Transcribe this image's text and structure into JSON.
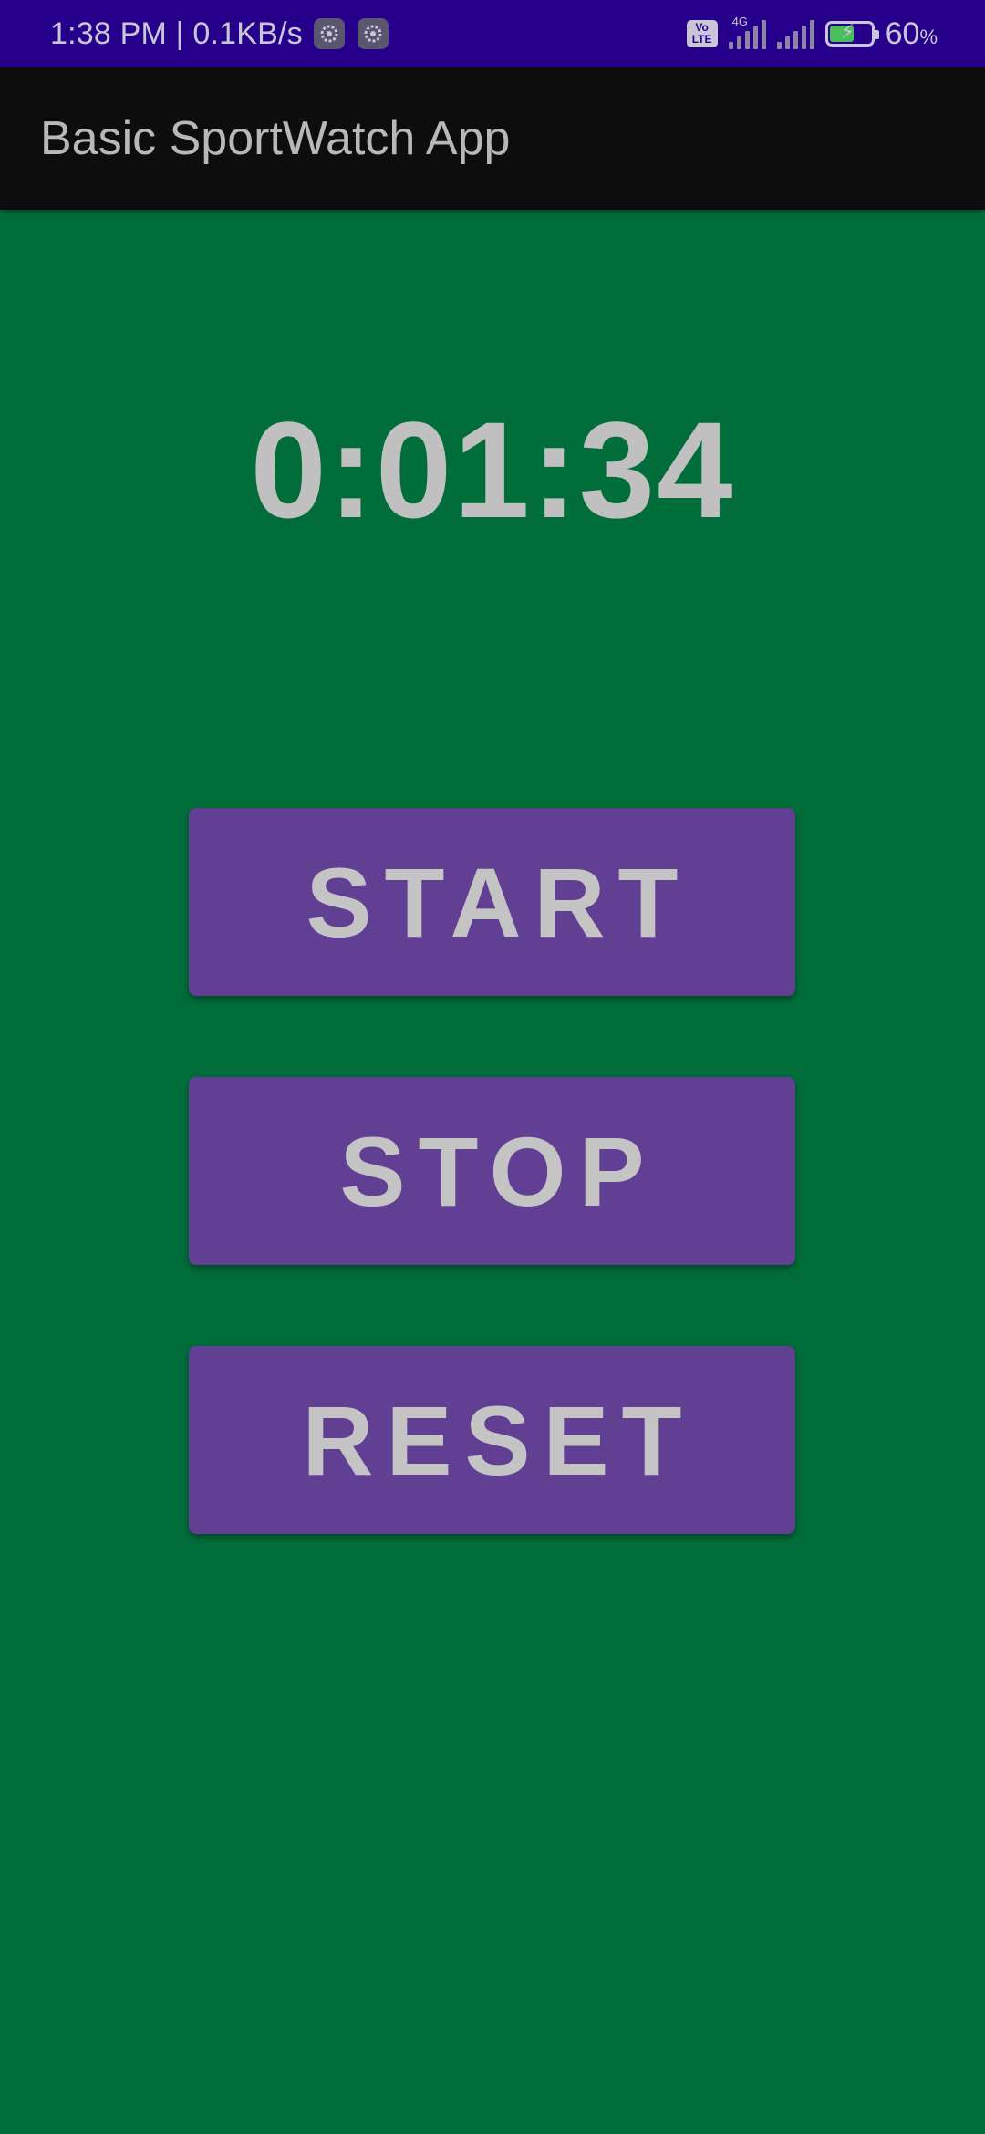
{
  "status_bar": {
    "time_speed": "1:38 PM | 0.1KB/s",
    "notification_icons": [
      "settings-gear-icon",
      "settings-gear-icon"
    ],
    "volte_top": "Vo",
    "volte_bottom": "LTE",
    "network_type": "4G",
    "battery_percent": "60",
    "battery_percent_sign": "%",
    "battery_level": 0.6,
    "charging": true
  },
  "app_bar": {
    "title": "Basic SportWatch App"
  },
  "timer": {
    "value": "0:01:34"
  },
  "buttons": {
    "start_label": "START",
    "stop_label": "STOP",
    "reset_label": "RESET"
  },
  "colors": {
    "status_bar_bg": "#26008a",
    "app_bar_bg": "#0d0d0d",
    "background": "#006d3a",
    "button_bg": "#613f93",
    "text": "#c0c0c0"
  }
}
